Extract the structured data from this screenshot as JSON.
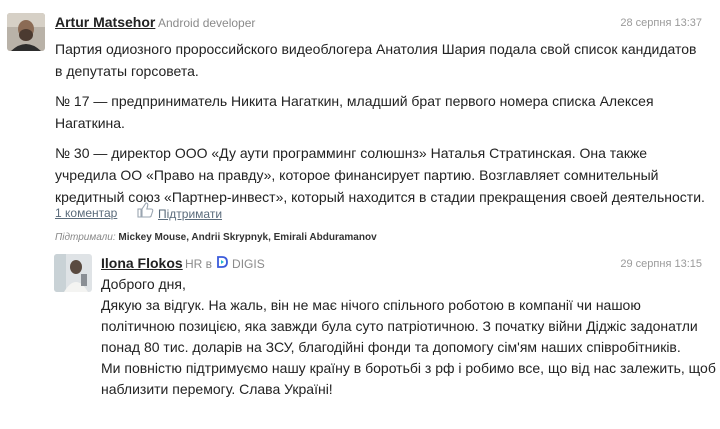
{
  "comment": {
    "author": "Artur Matsehor",
    "role": "Android developer",
    "date": "28 серпня 13:37",
    "paragraphs": [
      "Партия одиозного пророссийского видеоблогера Анатолия Шария подала свой список кандидатов в депутаты горсовета.",
      "№ 17 — предприниматель Никита Нагаткин, младший брат первого номера списка Алексея Нагаткина.",
      "№ 30 — директор ООО «Ду аути программинг солюшнз» Наталья Стратинская. Она также учредила ОО «Право на правду», которое финансирует партию. Возглавляет сомнительный кредитный союз «Партнер-инвест», который находится в стадии прекращения своей деятельности."
    ],
    "comments_link": "1 коментар",
    "support_label": "Підтримати",
    "supported_by_label": "Підтримали:",
    "supported_by_names": "Mickey Mouse, Andrii Skrypnyk, Emirali Abduramanov"
  },
  "reply": {
    "author": "Ilona Flokos",
    "role_prefix": "HR в",
    "company": "DIGIS",
    "date": "29 серпня 13:15",
    "lines": [
      "Доброго дня,",
      "Дякую за відгук. На жаль, він не має нічого спільного роботою в компанії чи нашою",
      "політичною позицією, яка завжди була суто патріотичною. З початку війни Діджіс задонатли",
      "понад 80 тис. доларів на ЗСУ, благодійні фонди та допомогу сім'ям наших співробітників.",
      "Ми повністю підтримуємо нашу країну в боротьбі з рф і робимо все, що від нас залежить, щоб",
      "наблизити перемогу. Слава Україні!"
    ]
  },
  "colors": {
    "link": "#5a6b7b",
    "muted": "#8a8a8a",
    "digis_logo": "#3b5bdb"
  }
}
